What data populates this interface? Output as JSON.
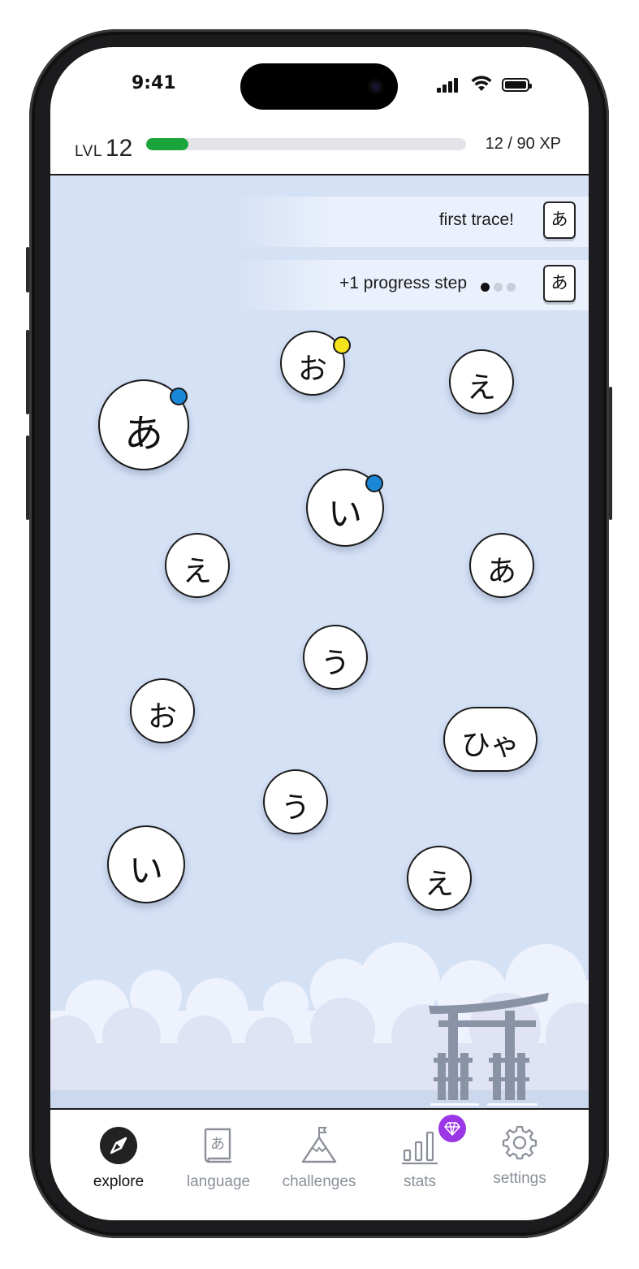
{
  "status_bar": {
    "time": "9:41"
  },
  "level": {
    "label": "LVL",
    "number": "12",
    "xp_text": "12 / 90 XP",
    "progress_fraction": 0.133,
    "bar_color": "#1aa53c"
  },
  "toasts": [
    {
      "text": "first trace!",
      "key": "あ"
    },
    {
      "text": "+1 progress step",
      "key": "あ",
      "steps_total": 3,
      "steps_done": 1
    }
  ],
  "bubbles": [
    {
      "char": "お",
      "badge": "yellow"
    },
    {
      "char": "え"
    },
    {
      "char": "あ",
      "badge": "blue"
    },
    {
      "char": "い",
      "badge": "blue"
    },
    {
      "char": "え"
    },
    {
      "char": "あ"
    },
    {
      "char": "う"
    },
    {
      "char": "お"
    },
    {
      "char": "ひゃ"
    },
    {
      "char": "う"
    },
    {
      "char": "い"
    },
    {
      "char": "え"
    }
  ],
  "badge_colors": {
    "blue": "#1a87d6",
    "yellow": "#f5e41c"
  },
  "scene": {
    "background": "#d5e1f5",
    "torii_color": "#8a93a6"
  },
  "nav": {
    "tabs": [
      {
        "label": "explore",
        "icon": "compass-icon",
        "active": true
      },
      {
        "label": "language",
        "icon": "book-icon",
        "icon_char": "あ",
        "active": false
      },
      {
        "label": "challenges",
        "icon": "mountain-flag-icon",
        "active": false
      },
      {
        "label": "stats",
        "icon": "bar-chart-icon",
        "active": false
      },
      {
        "label": "settings",
        "icon": "gear-icon",
        "active": false
      }
    ],
    "gem_badge_color": "#9b36e6"
  }
}
